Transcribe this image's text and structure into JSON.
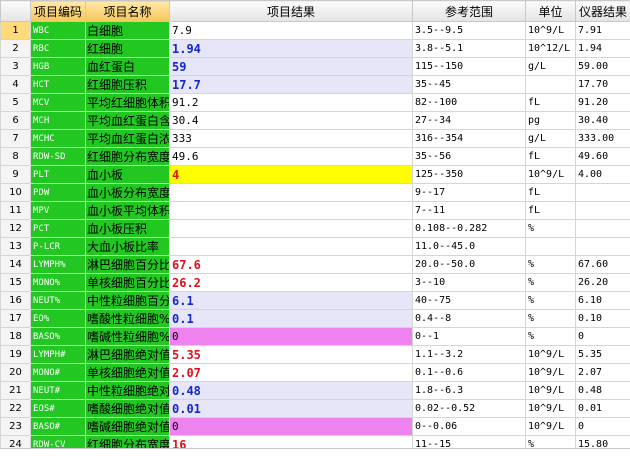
{
  "headers": [
    "",
    "项目编码",
    "项目名称",
    "项目结果",
    "参考范围",
    "单位",
    "仪器结果"
  ],
  "rows": [
    {
      "idx": "1",
      "code": "WBC",
      "name": "白细胞",
      "result": "7.9",
      "ref": "3.5--9.5",
      "unit": "10^9/L",
      "inst": "7.91",
      "style": "plain"
    },
    {
      "idx": "2",
      "code": "RBC",
      "name": "红细胞",
      "result": "1.94",
      "ref": "3.8--5.1",
      "unit": "10^12/L",
      "inst": "1.94",
      "style": "blue"
    },
    {
      "idx": "3",
      "code": "HGB",
      "name": "血红蛋白",
      "result": "59",
      "ref": "115--150",
      "unit": "g/L",
      "inst": "59.00",
      "style": "blue"
    },
    {
      "idx": "4",
      "code": "HCT",
      "name": "红细胞压积",
      "result": "17.7",
      "ref": "35--45",
      "unit": "",
      "inst": "17.70",
      "style": "blue"
    },
    {
      "idx": "5",
      "code": "MCV",
      "name": "平均红细胞体积",
      "result": "91.2",
      "ref": "82--100",
      "unit": "fL",
      "inst": "91.20",
      "style": "plain"
    },
    {
      "idx": "6",
      "code": "MCH",
      "name": "平均血红蛋白含量",
      "result": "30.4",
      "ref": "27--34",
      "unit": "pg",
      "inst": "30.40",
      "style": "plain"
    },
    {
      "idx": "7",
      "code": "MCHC",
      "name": "平均血红蛋白浓度",
      "result": "333",
      "ref": "316--354",
      "unit": "g/L",
      "inst": "333.00",
      "style": "plain"
    },
    {
      "idx": "8",
      "code": "RDW-SD",
      "name": "红细胞分布宽度",
      "result": "49.6",
      "ref": "35--56",
      "unit": "fL",
      "inst": "49.60",
      "style": "plain"
    },
    {
      "idx": "9",
      "code": "PLT",
      "name": "血小板",
      "result": "4",
      "ref": "125--350",
      "unit": "10^9/L",
      "inst": "4.00",
      "style": "yellow"
    },
    {
      "idx": "10",
      "code": "PDW",
      "name": "血小板分布宽度",
      "result": "",
      "ref": "9--17",
      "unit": "fL",
      "inst": "",
      "style": "plain"
    },
    {
      "idx": "11",
      "code": "MPV",
      "name": "血小板平均体积",
      "result": "",
      "ref": "7--11",
      "unit": "fL",
      "inst": "",
      "style": "plain"
    },
    {
      "idx": "12",
      "code": "PCT",
      "name": "血小板压积",
      "result": "",
      "ref": "0.108--0.282",
      "unit": "%",
      "inst": "",
      "style": "plain"
    },
    {
      "idx": "13",
      "code": "P-LCR",
      "name": "大血小板比率",
      "result": "",
      "ref": "11.0--45.0",
      "unit": "",
      "inst": "",
      "style": "plain"
    },
    {
      "idx": "14",
      "code": "LYMPH%",
      "name": "淋巴细胞百分比",
      "result": "67.6",
      "ref": "20.0--50.0",
      "unit": "%",
      "inst": "67.60",
      "style": "red"
    },
    {
      "idx": "15",
      "code": "MONO%",
      "name": "单核细胞百分比",
      "result": "26.2",
      "ref": "3--10",
      "unit": "%",
      "inst": "26.20",
      "style": "red"
    },
    {
      "idx": "16",
      "code": "NEUT%",
      "name": "中性粒细胞百分比",
      "result": "6.1",
      "ref": "40--75",
      "unit": "%",
      "inst": "6.10",
      "style": "blue"
    },
    {
      "idx": "17",
      "code": "EO%",
      "name": "嗜酸性粒细胞%",
      "result": "0.1",
      "ref": "0.4--8",
      "unit": "%",
      "inst": "0.10",
      "style": "blue"
    },
    {
      "idx": "18",
      "code": "BASO%",
      "name": "嗜碱性粒细胞%",
      "result": "0",
      "ref": "0--1",
      "unit": "%",
      "inst": "0",
      "style": "pink"
    },
    {
      "idx": "19",
      "code": "LYMPH#",
      "name": "淋巴细胞绝对值",
      "result": "5.35",
      "ref": "1.1--3.2",
      "unit": "10^9/L",
      "inst": "5.35",
      "style": "red"
    },
    {
      "idx": "20",
      "code": "MONO#",
      "name": "单核细胞绝对值",
      "result": "2.07",
      "ref": "0.1--0.6",
      "unit": "10^9/L",
      "inst": "2.07",
      "style": "red"
    },
    {
      "idx": "21",
      "code": "NEUT#",
      "name": "中性粒细胞绝对值",
      "result": "0.48",
      "ref": "1.8--6.3",
      "unit": "10^9/L",
      "inst": "0.48",
      "style": "blue"
    },
    {
      "idx": "22",
      "code": "EOS#",
      "name": "嗜酸细胞绝对值",
      "result": "0.01",
      "ref": "0.02--0.52",
      "unit": "10^9/L",
      "inst": "0.01",
      "style": "blue"
    },
    {
      "idx": "23",
      "code": "BASO#",
      "name": "嗜碱细胞绝对值",
      "result": "0",
      "ref": "0--0.06",
      "unit": "10^9/L",
      "inst": "0",
      "style": "pink"
    },
    {
      "idx": "24",
      "code": "RDW-CV",
      "name": "红细胞分布宽度",
      "result": "16",
      "ref": "11--15",
      "unit": "%",
      "inst": "15.80",
      "style": "red"
    }
  ],
  "selected_row": "1",
  "colors": {
    "code_bg": "#22c722",
    "blue_text": "#1428c8",
    "red_text": "#e0101c",
    "lavender": "#e6e6f8",
    "yellow": "#ffff00",
    "pink": "#ee82ee"
  }
}
